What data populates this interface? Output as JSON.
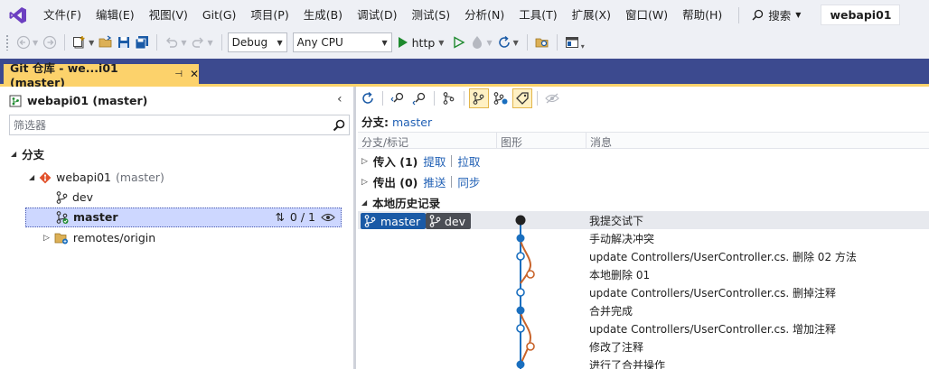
{
  "menu": {
    "items": [
      "文件(F)",
      "编辑(E)",
      "视图(V)",
      "Git(G)",
      "项目(P)",
      "生成(B)",
      "调试(D)",
      "测试(S)",
      "分析(N)",
      "工具(T)",
      "扩展(X)",
      "窗口(W)",
      "帮助(H)"
    ],
    "search_label": "搜索",
    "solution_name": "webapi01"
  },
  "toolbar": {
    "config": "Debug",
    "platform": "Any CPU",
    "run_label": "http"
  },
  "tab": {
    "title": "Git 仓库 - we...i01 (master)"
  },
  "left": {
    "repo_title": "webapi01 (master)",
    "filter_placeholder": "筛选器",
    "section_label": "分支",
    "tree": {
      "repo_name": "webapi01",
      "repo_suffix": "(master)",
      "dev": "dev",
      "master": "master",
      "master_sync": "0 / 1",
      "remotes": "remotes/origin"
    }
  },
  "right": {
    "branch_label": "分支:",
    "branch_value": "master",
    "columns": {
      "branch_tag": "分支/标记",
      "graph": "图形",
      "message": "消息"
    },
    "incoming": {
      "label": "传入 (1)",
      "fetch": "提取",
      "pull": "拉取"
    },
    "outgoing": {
      "label": "传出 (0)",
      "push": "推送",
      "sync": "同步"
    },
    "history_label": "本地历史记录",
    "tags": {
      "master": "master",
      "dev": "dev"
    },
    "commits": [
      "我提交试下",
      "手动解决冲突",
      "update Controllers/UserController.cs. 删除  02 方法",
      "本地删除 01",
      "update Controllers/UserController.cs. 删掉注释",
      "合并完成",
      "update Controllers/UserController.cs. 增加注释",
      "修改了注释",
      "进行了合并操作"
    ]
  },
  "colors": {
    "accent_tab": "#fcd26b",
    "band": "#3c4a8f",
    "selection": "#cdd7ff",
    "link": "#1f5fb4",
    "graph_blue": "#1a6fbf",
    "graph_orange": "#c8632a"
  }
}
